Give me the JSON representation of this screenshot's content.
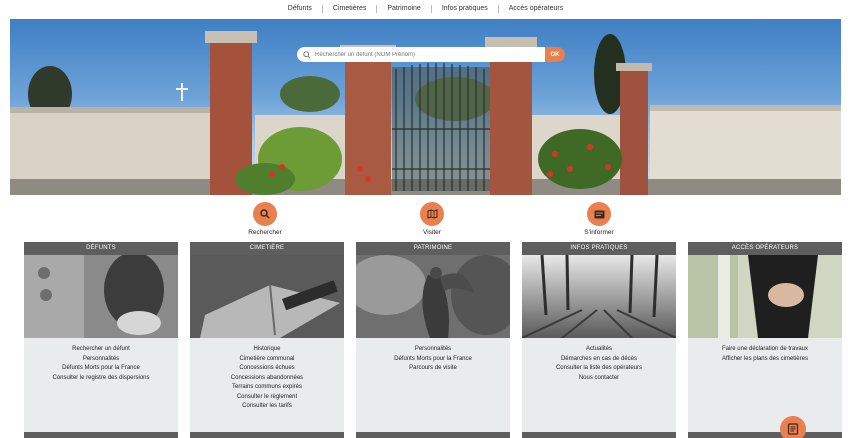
{
  "nav": {
    "items": [
      "Défunts",
      "Cimetières",
      "Patrimoine",
      "Infos pratiques",
      "Accès opérateurs"
    ]
  },
  "search": {
    "placeholder": "Rechercher un défunt (NOM Prénom)",
    "button": "OK"
  },
  "quick_actions": [
    {
      "label": "Rechercher",
      "icon": "search-icon"
    },
    {
      "label": "Visiter",
      "icon": "map-icon"
    },
    {
      "label": "S'informer",
      "icon": "info-card-icon"
    }
  ],
  "cards": [
    {
      "title": "DÉFUNTS",
      "links": [
        "Rechercher un défunt",
        "Personnalités",
        "Défunts Morts pour la France",
        "Consulter le registre des dispersions"
      ]
    },
    {
      "title": "CIMETIÈRE",
      "links": [
        "Historique",
        "Cimetière communal",
        "Concessions échues",
        "Concessions abandonnées",
        "Terrains communs expirés",
        "Consulter le règlement",
        "Consulter les tarifs"
      ]
    },
    {
      "title": "PATRIMOINE",
      "links": [
        "Personnalités",
        "Défunts Morts pour la France",
        "Parcours de visite"
      ]
    },
    {
      "title": "INFOS PRATIQUES",
      "links": [
        "Actualités",
        "Démarches en cas de décès",
        "Consulter la liste des opérateurs",
        "Nous contacter"
      ]
    },
    {
      "title": "ACCÈS OPÉRATEURS",
      "links": [
        "Faire une déclaration de travaux",
        "Afficher les plans des cimetières"
      ]
    }
  ],
  "colors": {
    "accent": "#e8804f",
    "card_header": "#5e5e5e",
    "card_bg": "#e9ecec"
  },
  "fab": {
    "icon": "document-icon"
  }
}
